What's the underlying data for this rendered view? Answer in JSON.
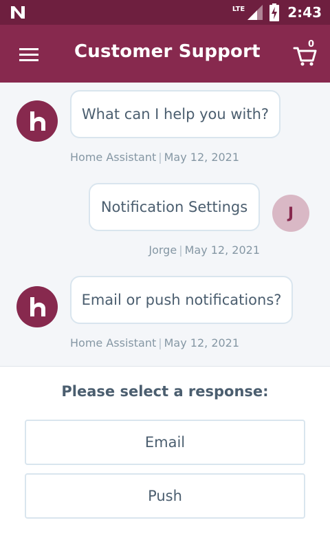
{
  "status_bar": {
    "network": "LTE",
    "time": "2:43"
  },
  "app_bar": {
    "title": "Customer Support",
    "cart_count": "0"
  },
  "messages": [
    {
      "sender": "bot",
      "text": "What can I help you with?",
      "author": "Home Assistant",
      "date": "May 12, 2021"
    },
    {
      "sender": "user",
      "avatar_initial": "J",
      "text": "Notification Settings",
      "author": "Jorge",
      "date": "May 12, 2021"
    },
    {
      "sender": "bot",
      "text": "Email or push notifications?",
      "author": "Home Assistant",
      "date": "May 12, 2021"
    }
  ],
  "response": {
    "prompt": "Please select a response:",
    "options": [
      "Email",
      "Push"
    ]
  },
  "colors": {
    "status_bar": "#6e1f3f",
    "brand": "#87294e",
    "user_avatar": "#d9b8c5",
    "text": "#4b5e6f",
    "meta_text": "#8597a4"
  }
}
